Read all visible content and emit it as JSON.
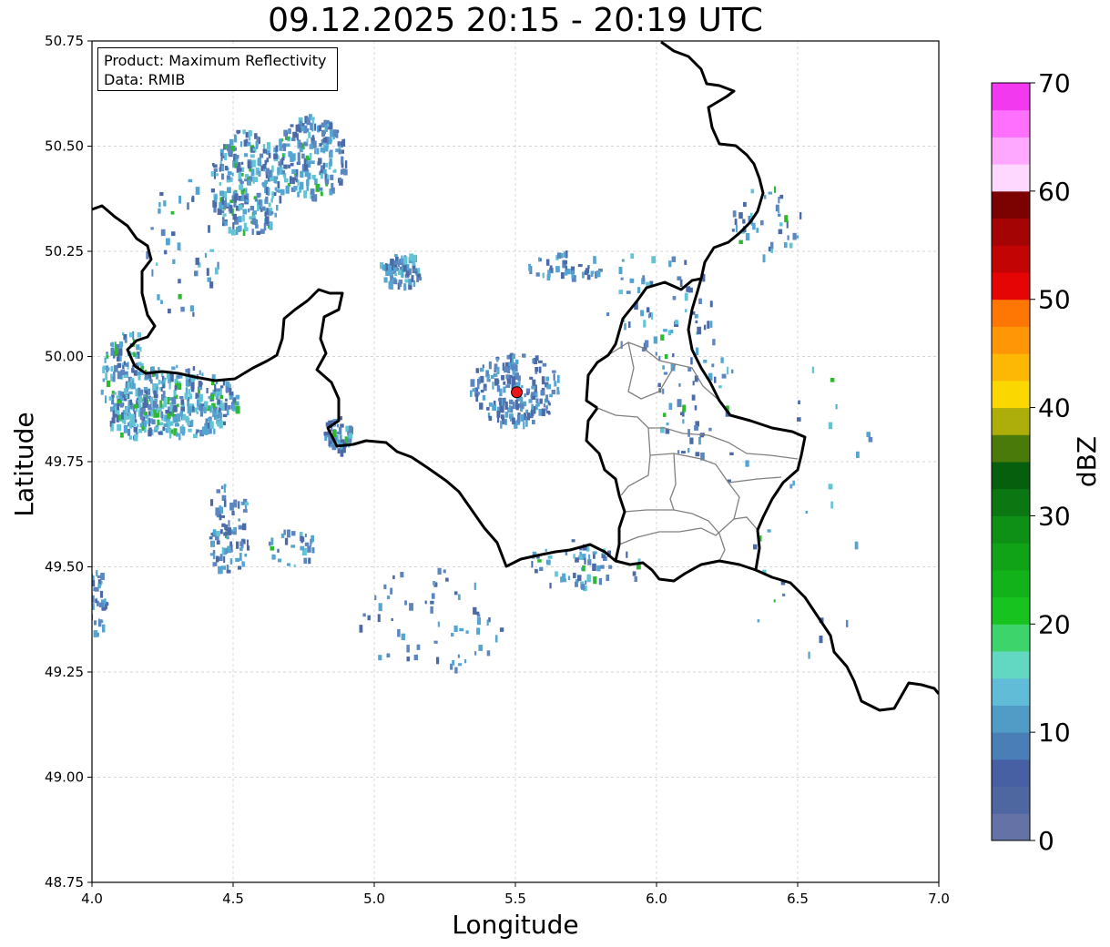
{
  "title": "09.12.2025 20:15 - 20:19 UTC",
  "info_box": {
    "product": "Product: Maximum Reflectivity",
    "data": "Data: RMIB"
  },
  "axes": {
    "xlabel": "Longitude",
    "ylabel": "Latitude",
    "xlim": [
      4.0,
      7.0
    ],
    "ylim": [
      48.75,
      50.75
    ],
    "xticks": [
      "4.0",
      "4.5",
      "5.0",
      "5.5",
      "6.0",
      "6.5",
      "7.0"
    ],
    "yticks": [
      "48.75",
      "49.00",
      "49.25",
      "49.50",
      "49.75",
      "50.00",
      "50.25",
      "50.50",
      "50.75"
    ],
    "grid": true
  },
  "radar_site": {
    "lon": 5.505,
    "lat": 49.915,
    "color": "#e8161b"
  },
  "colorbar": {
    "label": "dBZ",
    "min": 0,
    "max": 70,
    "tick_labels": [
      "0",
      "10",
      "20",
      "30",
      "40",
      "50",
      "60",
      "70"
    ],
    "colors": [
      "#6472a6",
      "#4f67a0",
      "#4760a4",
      "#4a7eb7",
      "#509cc7",
      "#61bcd8",
      "#62d8c3",
      "#3dd46c",
      "#17c41f",
      "#12b21b",
      "#10a318",
      "#0e8f15",
      "#0a7712",
      "#065f0c",
      "#4a7a0a",
      "#aeae0a",
      "#fbd702",
      "#fdb705",
      "#fe9605",
      "#fe7705",
      "#e50505",
      "#c30404",
      "#a40404",
      "#7c0101",
      "#ffd8ff",
      "#ffa8ff",
      "#ff70ff",
      "#f239f0"
    ]
  },
  "echo_palette": [
    "#4a6aa8",
    "#5b86c0",
    "#55a5d2",
    "#63c4d6",
    "#2fb832",
    "#10981a"
  ],
  "colors": {
    "border": "#000000",
    "internal_border": "#808080",
    "grid": "#c8c8c8"
  }
}
